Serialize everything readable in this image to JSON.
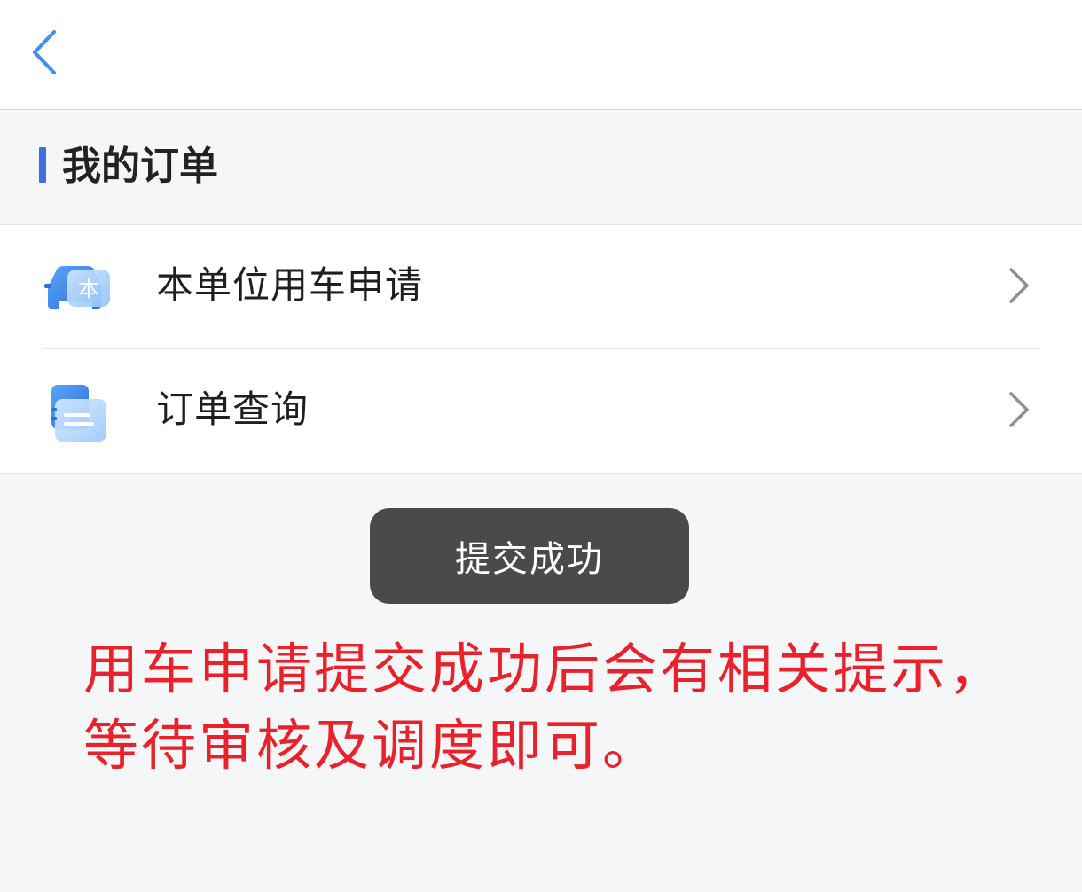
{
  "section": {
    "title": "我的订单"
  },
  "menu": {
    "items": [
      {
        "label": "本单位用车申请",
        "icon": "car-icon",
        "icon_char": "本"
      },
      {
        "label": "订单查询",
        "icon": "document-list-icon"
      }
    ]
  },
  "toast": {
    "text": "提交成功"
  },
  "annotation": {
    "lines": [
      "用车申请提交成功后会有相关提示，",
      "等待审核及调度即可。"
    ]
  },
  "colors": {
    "accent": "#3f6fe0",
    "toast_bg": "#4a4a4a",
    "annotation": "#e8212b",
    "back_icon": "#3f8ef0"
  }
}
